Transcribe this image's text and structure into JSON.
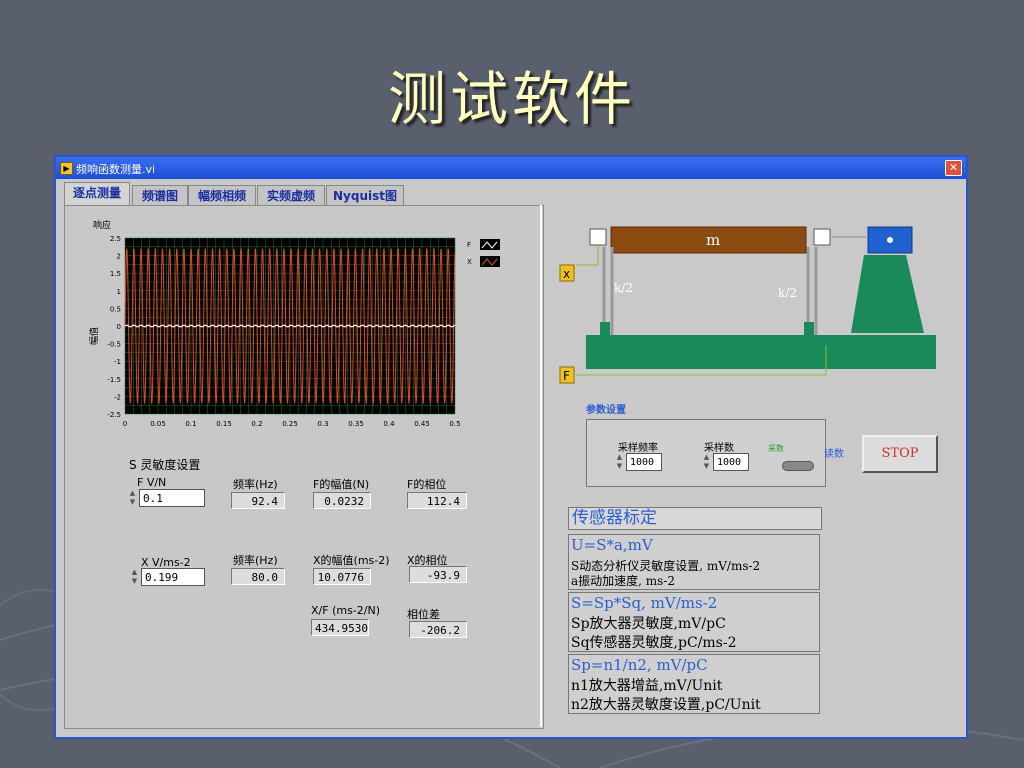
{
  "slide": {
    "title": "测试软件"
  },
  "window": {
    "title": "频响函数测量.vi",
    "close": "✕"
  },
  "tabs": [
    "逐点测量",
    "频谱图",
    "幅频相频",
    "实频虚频",
    "Nyquist图"
  ],
  "chart_data": {
    "type": "line",
    "title": "响应",
    "ylabel": "幅值",
    "xlim": [
      0,
      0.5
    ],
    "ylim": [
      -2.5,
      2.5
    ],
    "xticks": [
      "0",
      "0.05",
      "0.1",
      "0.15",
      "0.2",
      "0.25",
      "0.3",
      "0.35",
      "0.4",
      "0.45",
      "0.5"
    ],
    "yticks": [
      "2.5",
      "2",
      "1.5",
      "1",
      "0.5",
      "0",
      "-0.5",
      "-1",
      "-1.5",
      "-2",
      "-2.5"
    ],
    "grid": true,
    "legend_placement": "top-right",
    "series": [
      {
        "name": "F",
        "color": "#ffffff",
        "frequency_hz": 92.4,
        "amplitude": 0.0232
      },
      {
        "name": "X",
        "color": "#e04a2a",
        "frequency_hz": 92.4,
        "amplitude": 2.2
      }
    ]
  },
  "sens": {
    "section_label": "S 灵敏度设置",
    "f_label": "F V/N",
    "f_value": "0.1",
    "x_label": "X V/ms-2",
    "x_value": "0.199"
  },
  "f_meas": {
    "freq_label": "频率(Hz)",
    "freq_value": "92.4",
    "amp_label": "F的幅值(N)",
    "amp_value": "0.0232",
    "phase_label": "F的相位",
    "phase_value": "112.4"
  },
  "x_meas": {
    "freq_label": "频率(Hz)",
    "freq_value": "80.0",
    "amp_label": "X的幅值(ms-2)",
    "amp_value": "10.0776",
    "phase_label": "X的相位",
    "phase_value": "-93.9"
  },
  "ratio": {
    "xf_label": "X/F (ms-2/N)",
    "xf_value": "434.9530",
    "diff_label": "相位差",
    "diff_value": "-206.2"
  },
  "diagram": {
    "mass": "m",
    "k_left": "k/2",
    "k_right": "k/2",
    "x_tag": "x",
    "f_tag": "F"
  },
  "params": {
    "title": "参数设置",
    "rate_label": "采样频率",
    "rate_value": "1000",
    "count_label": "采样数",
    "count_value": "1000",
    "toggle_on_label": "采数",
    "toggle_read_label": "读数",
    "stop": "STOP"
  },
  "calib": {
    "title": "传感器标定",
    "box1": {
      "head": "U=S*a,mV",
      "l1": "S动态分析仪灵敏度设置, mV/ms-2",
      "l2": "a振动加速度, ms-2"
    },
    "box2": {
      "head": "S=Sp*Sq, mV/ms-2",
      "l1": "Sp放大器灵敏度,mV/pC",
      "l2": "Sq传感器灵敏度,pC/ms-2"
    },
    "box3": {
      "head": "Sp=n1/n2, mV/pC",
      "l1": "n1放大器增益,mV/Unit",
      "l2": "n2放大器灵敏度设置,pC/Unit"
    }
  },
  "colors": {
    "accent": "#2e5fd0",
    "series_x": "#e04a2a",
    "series_f": "#ffffff",
    "plot_bg": "#000000",
    "grid": "#1f7a1f",
    "base_green": "#1a8a5a",
    "mass_brown": "#8b4a10"
  }
}
